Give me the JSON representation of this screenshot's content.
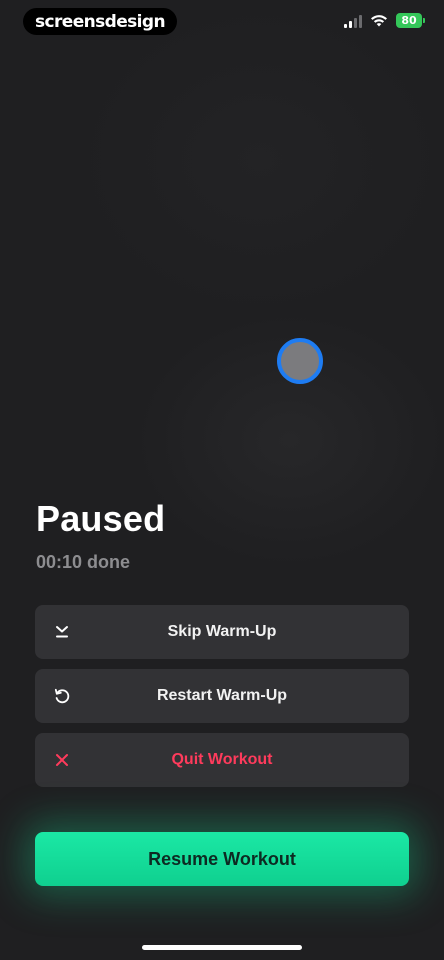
{
  "status_bar": {
    "brand": "screensdesign",
    "battery": "80",
    "signal_icon": "cellular-signal-icon",
    "wifi_icon": "wifi-icon"
  },
  "workout": {
    "title": "Paused",
    "elapsed": "00:10 done"
  },
  "actions": [
    {
      "label": "Skip Warm-Up",
      "icon": "skip-icon"
    },
    {
      "label": "Restart Warm-Up",
      "icon": "restart-icon"
    },
    {
      "label": "Quit Workout",
      "icon": "close-icon"
    }
  ],
  "primary_action": {
    "label": "Resume Workout"
  },
  "colors": {
    "background": "#1f1f21",
    "row_background": "#323235",
    "danger": "#ff3b5c",
    "accent": "#14e09b",
    "touch_ring": "#1e7cf2"
  }
}
